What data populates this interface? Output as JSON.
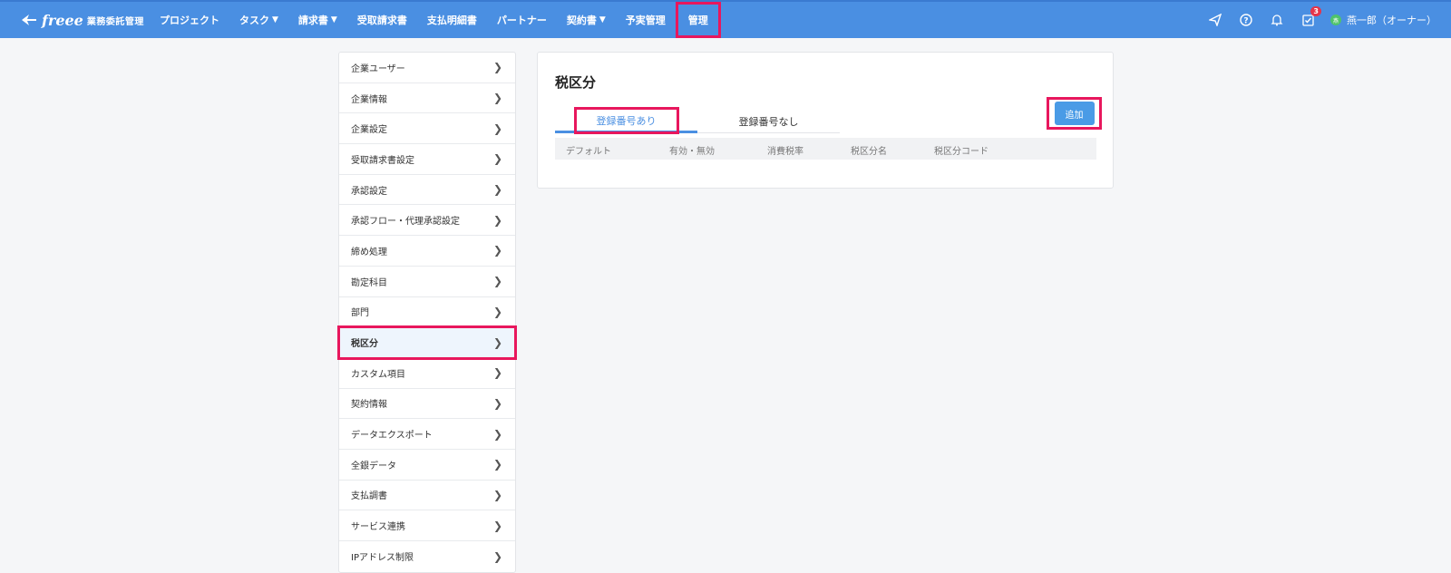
{
  "header": {
    "brand": "freee",
    "product": "業務委託管理",
    "nav": [
      {
        "label": "プロジェクト",
        "dropdown": false
      },
      {
        "label": "タスク",
        "dropdown": true
      },
      {
        "label": "請求書",
        "dropdown": true
      },
      {
        "label": "受取請求書",
        "dropdown": false
      },
      {
        "label": "支払明細書",
        "dropdown": false
      },
      {
        "label": "パートナー",
        "dropdown": false
      },
      {
        "label": "契約書",
        "dropdown": true
      },
      {
        "label": "予実管理",
        "dropdown": false
      },
      {
        "label": "管理",
        "dropdown": false
      }
    ],
    "notification_count": "3",
    "user_initial": "燕",
    "user_name": "燕一郎（オーナー）"
  },
  "sidebar": {
    "items": [
      {
        "label": "企業ユーザー"
      },
      {
        "label": "企業情報"
      },
      {
        "label": "企業設定"
      },
      {
        "label": "受取請求書設定"
      },
      {
        "label": "承認設定"
      },
      {
        "label": "承認フロー・代理承認設定"
      },
      {
        "label": "締め処理"
      },
      {
        "label": "勘定科目"
      },
      {
        "label": "部門"
      },
      {
        "label": "税区分",
        "active": true
      },
      {
        "label": "カスタム項目"
      },
      {
        "label": "契約情報"
      },
      {
        "label": "データエクスポート"
      },
      {
        "label": "全銀データ"
      },
      {
        "label": "支払調書"
      },
      {
        "label": "サービス連携"
      },
      {
        "label": "IPアドレス制限"
      }
    ]
  },
  "main": {
    "title": "税区分",
    "tabs": [
      {
        "label": "登録番号あり",
        "active": true
      },
      {
        "label": "登録番号なし",
        "active": false
      }
    ],
    "add_label": "追加",
    "columns": [
      "デフォルト",
      "有効・無効",
      "消費税率",
      "税区分名",
      "税区分コード"
    ]
  },
  "colors": {
    "header_bg": "#4a8fe2",
    "highlight": "#e8175d",
    "primary_button": "#4a9be6"
  }
}
